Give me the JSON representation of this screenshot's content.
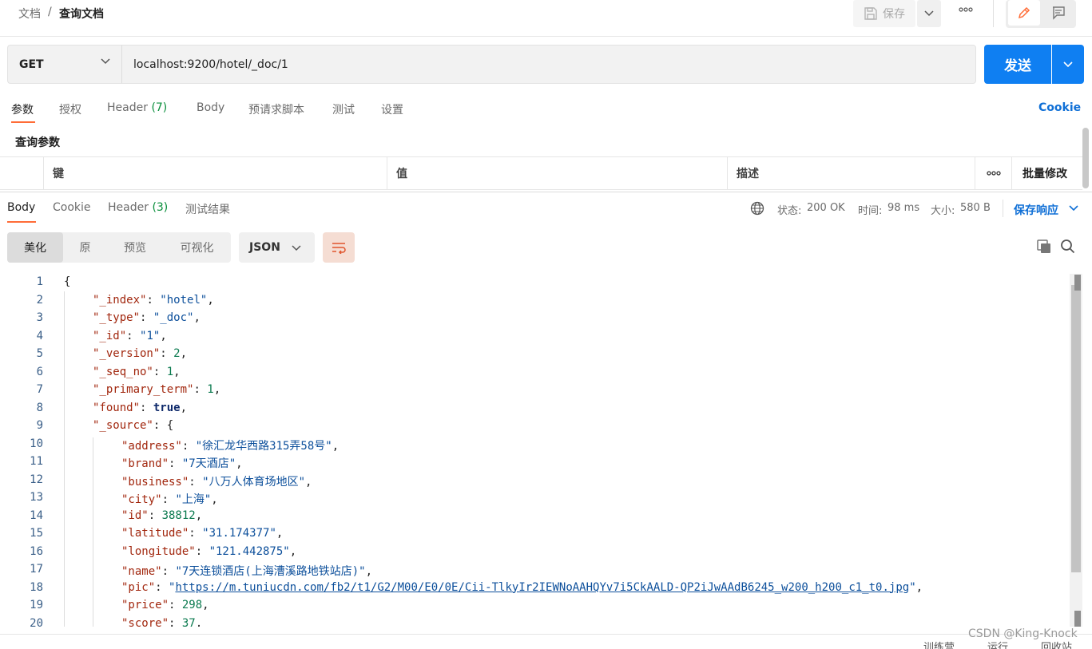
{
  "breadcrumb": {
    "parent": "文档",
    "separator": "/",
    "current": "查询文档"
  },
  "toolbar": {
    "save_label": "保存",
    "more_label": "ooo"
  },
  "request": {
    "method": "GET",
    "url": "localhost:9200/hotel/_doc/1",
    "send_label": "发送"
  },
  "request_tabs": {
    "params": "参数",
    "auth": "授权",
    "header": "Header",
    "header_count": "(7)",
    "body": "Body",
    "prerequest": "预请求脚本",
    "tests": "测试",
    "settings": "设置",
    "cookie": "Cookie"
  },
  "query_params": {
    "title": "查询参数",
    "col_key": "键",
    "col_value": "值",
    "col_desc": "描述",
    "more": "ooo",
    "bulk_edit": "批量修改"
  },
  "response_tabs": {
    "body": "Body",
    "cookie": "Cookie",
    "header": "Header",
    "header_count": "(3)",
    "test_results": "测试结果"
  },
  "status": {
    "status_label": "状态:",
    "status_value": "200 OK",
    "time_label": "时间:",
    "time_value": "98 ms",
    "size_label": "大小:",
    "size_value": "580 B",
    "save_response": "保存响应"
  },
  "view_modes": {
    "pretty": "美化",
    "raw": "原",
    "preview": "预览",
    "visualize": "可视化"
  },
  "format": "JSON",
  "code_lines": [
    {
      "n": "1",
      "indent": 0,
      "tokens": [
        {
          "c": "p",
          "t": "{"
        }
      ]
    },
    {
      "n": "2",
      "indent": 1,
      "tokens": [
        {
          "c": "k",
          "t": "\"_index\""
        },
        {
          "c": "p",
          "t": ": "
        },
        {
          "c": "s",
          "t": "\"hotel\""
        },
        {
          "c": "p",
          "t": ","
        }
      ]
    },
    {
      "n": "3",
      "indent": 1,
      "tokens": [
        {
          "c": "k",
          "t": "\"_type\""
        },
        {
          "c": "p",
          "t": ": "
        },
        {
          "c": "s",
          "t": "\"_doc\""
        },
        {
          "c": "p",
          "t": ","
        }
      ]
    },
    {
      "n": "4",
      "indent": 1,
      "tokens": [
        {
          "c": "k",
          "t": "\"_id\""
        },
        {
          "c": "p",
          "t": ": "
        },
        {
          "c": "s",
          "t": "\"1\""
        },
        {
          "c": "p",
          "t": ","
        }
      ]
    },
    {
      "n": "5",
      "indent": 1,
      "tokens": [
        {
          "c": "k",
          "t": "\"_version\""
        },
        {
          "c": "p",
          "t": ": "
        },
        {
          "c": "n",
          "t": "2"
        },
        {
          "c": "p",
          "t": ","
        }
      ]
    },
    {
      "n": "6",
      "indent": 1,
      "tokens": [
        {
          "c": "k",
          "t": "\"_seq_no\""
        },
        {
          "c": "p",
          "t": ": "
        },
        {
          "c": "n",
          "t": "1"
        },
        {
          "c": "p",
          "t": ","
        }
      ]
    },
    {
      "n": "7",
      "indent": 1,
      "tokens": [
        {
          "c": "k",
          "t": "\"_primary_term\""
        },
        {
          "c": "p",
          "t": ": "
        },
        {
          "c": "n",
          "t": "1"
        },
        {
          "c": "p",
          "t": ","
        }
      ]
    },
    {
      "n": "8",
      "indent": 1,
      "tokens": [
        {
          "c": "k",
          "t": "\"found\""
        },
        {
          "c": "p",
          "t": ": "
        },
        {
          "c": "b",
          "t": "true"
        },
        {
          "c": "p",
          "t": ","
        }
      ]
    },
    {
      "n": "9",
      "indent": 1,
      "tokens": [
        {
          "c": "k",
          "t": "\"_source\""
        },
        {
          "c": "p",
          "t": ": {"
        }
      ]
    },
    {
      "n": "10",
      "indent": 2,
      "tokens": [
        {
          "c": "k",
          "t": "\"address\""
        },
        {
          "c": "p",
          "t": ": "
        },
        {
          "c": "s",
          "t": "\"徐汇龙华西路315弄58号\""
        },
        {
          "c": "p",
          "t": ","
        }
      ]
    },
    {
      "n": "11",
      "indent": 2,
      "tokens": [
        {
          "c": "k",
          "t": "\"brand\""
        },
        {
          "c": "p",
          "t": ": "
        },
        {
          "c": "s",
          "t": "\"7天酒店\""
        },
        {
          "c": "p",
          "t": ","
        }
      ]
    },
    {
      "n": "12",
      "indent": 2,
      "tokens": [
        {
          "c": "k",
          "t": "\"business\""
        },
        {
          "c": "p",
          "t": ": "
        },
        {
          "c": "s",
          "t": "\"八万人体育场地区\""
        },
        {
          "c": "p",
          "t": ","
        }
      ]
    },
    {
      "n": "13",
      "indent": 2,
      "tokens": [
        {
          "c": "k",
          "t": "\"city\""
        },
        {
          "c": "p",
          "t": ": "
        },
        {
          "c": "s",
          "t": "\"上海\""
        },
        {
          "c": "p",
          "t": ","
        }
      ]
    },
    {
      "n": "14",
      "indent": 2,
      "tokens": [
        {
          "c": "k",
          "t": "\"id\""
        },
        {
          "c": "p",
          "t": ": "
        },
        {
          "c": "n",
          "t": "38812"
        },
        {
          "c": "p",
          "t": ","
        }
      ]
    },
    {
      "n": "15",
      "indent": 2,
      "tokens": [
        {
          "c": "k",
          "t": "\"latitude\""
        },
        {
          "c": "p",
          "t": ": "
        },
        {
          "c": "s",
          "t": "\"31.174377\""
        },
        {
          "c": "p",
          "t": ","
        }
      ]
    },
    {
      "n": "16",
      "indent": 2,
      "tokens": [
        {
          "c": "k",
          "t": "\"longitude\""
        },
        {
          "c": "p",
          "t": ": "
        },
        {
          "c": "s",
          "t": "\"121.442875\""
        },
        {
          "c": "p",
          "t": ","
        }
      ]
    },
    {
      "n": "17",
      "indent": 2,
      "tokens": [
        {
          "c": "k",
          "t": "\"name\""
        },
        {
          "c": "p",
          "t": ": "
        },
        {
          "c": "s",
          "t": "\"7天连锁酒店(上海漕溪路地铁站店)\""
        },
        {
          "c": "p",
          "t": ","
        }
      ]
    },
    {
      "n": "18",
      "indent": 2,
      "tokens": [
        {
          "c": "k",
          "t": "\"pic\""
        },
        {
          "c": "p",
          "t": ": "
        },
        {
          "c": "s",
          "t": "\""
        },
        {
          "c": "u",
          "t": "https://m.tuniucdn.com/fb2/t1/G2/M00/E0/0E/Cii-TlkyIr2IEWNoAAHQYv7i5CkAALD-QP2iJwAAdB6245_w200_h200_c1_t0.jpg"
        },
        {
          "c": "s",
          "t": "\""
        },
        {
          "c": "p",
          "t": ","
        }
      ]
    },
    {
      "n": "19",
      "indent": 2,
      "tokens": [
        {
          "c": "k",
          "t": "\"price\""
        },
        {
          "c": "p",
          "t": ": "
        },
        {
          "c": "n",
          "t": "298"
        },
        {
          "c": "p",
          "t": ","
        }
      ]
    },
    {
      "n": "20",
      "indent": 2,
      "tokens": [
        {
          "c": "k",
          "t": "\"score\""
        },
        {
          "c": "p",
          "t": ": "
        },
        {
          "c": "n",
          "t": "37"
        },
        {
          "c": "p",
          "t": ","
        }
      ]
    }
  ],
  "footer": {
    "train": "训练营",
    "run": "运行",
    "trash": "回收站"
  },
  "watermark": "CSDN @King-Knock",
  "colors": {
    "accent": "#ff6c37",
    "send_button": "#0f7ff2",
    "status_ok": "#0a8f3c",
    "link": "#0f6fd6"
  },
  "icons": [
    "save-icon",
    "chevron-down-icon",
    "more-icon",
    "pencil-icon",
    "comment-icon",
    "globe-icon",
    "wrap-lines-icon",
    "copy-icon",
    "search-icon"
  ]
}
